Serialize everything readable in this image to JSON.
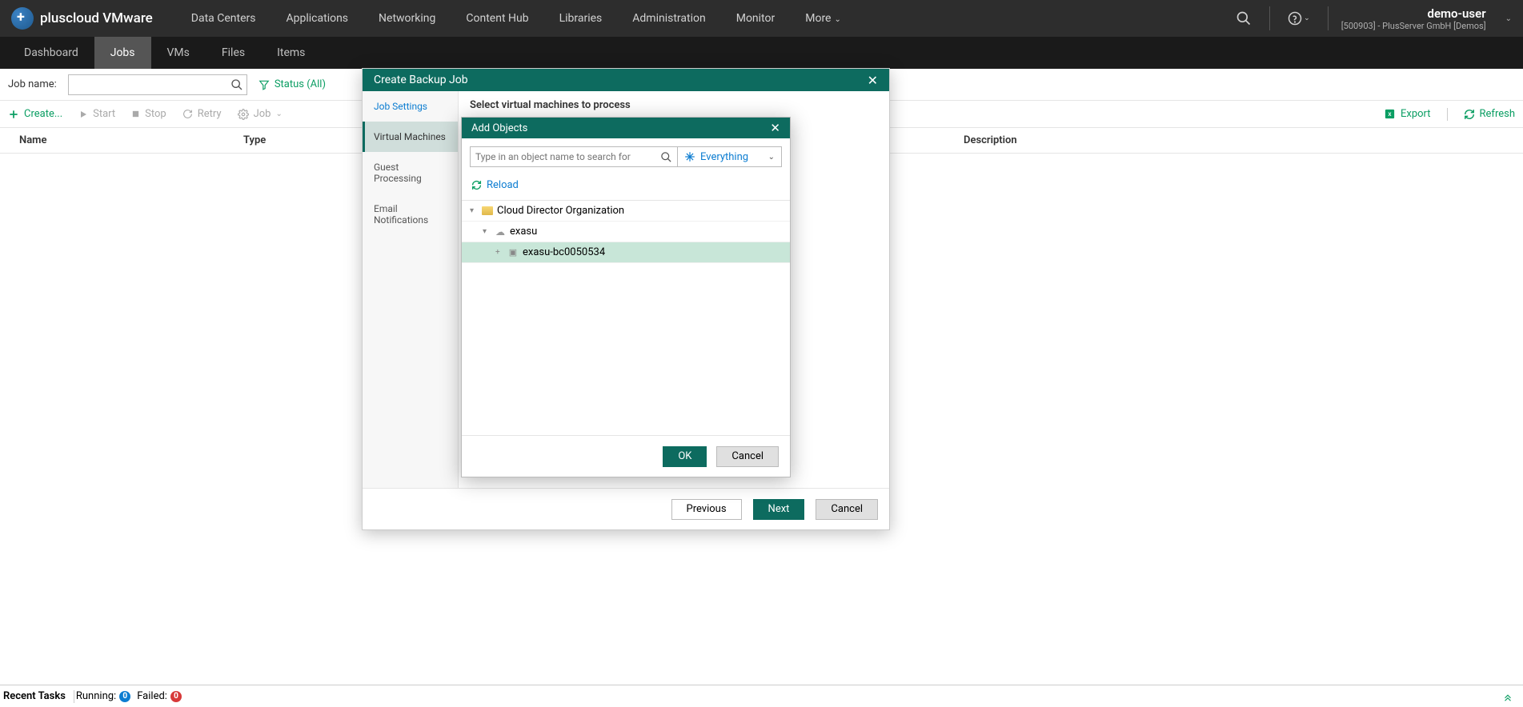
{
  "brand": "pluscloud VMware",
  "topNav": [
    "Data Centers",
    "Applications",
    "Networking",
    "Content Hub",
    "Libraries",
    "Administration",
    "Monitor",
    "More"
  ],
  "user": {
    "name": "demo-user",
    "org": "[500903] - PlusServer GmbH [Demos]"
  },
  "subNav": [
    "Dashboard",
    "Jobs",
    "VMs",
    "Files",
    "Items"
  ],
  "subNavActive": 1,
  "toolbar": {
    "jobNameLabel": "Job name:",
    "statusFilter": "Status (All)"
  },
  "actions": {
    "create": "Create...",
    "start": "Start",
    "stop": "Stop",
    "retry": "Retry",
    "job": "Job",
    "export": "Export",
    "refresh": "Refresh"
  },
  "columns": {
    "name": "Name",
    "type": "Type",
    "desc": "Description"
  },
  "footer": {
    "recent": "Recent Tasks",
    "running": "Running:",
    "runningCount": "0",
    "failed": "Failed:",
    "failedCount": "0"
  },
  "modal1": {
    "title": "Create Backup Job",
    "steps": [
      "Job Settings",
      "Virtual Machines",
      "Guest Processing",
      "Email Notifications"
    ],
    "activeStep": 1,
    "contentTitle": "Select virtual machines to process",
    "prev": "Previous",
    "next": "Next",
    "cancel": "Cancel"
  },
  "modal2": {
    "title": "Add Objects",
    "searchPlaceholder": "Type in an object name to search for",
    "filterLabel": "Everything",
    "reload": "Reload",
    "tree": {
      "root": "Cloud Director Organization",
      "child1": "exasu",
      "child2": "exasu-bc0050534"
    },
    "ok": "OK",
    "cancel": "Cancel"
  }
}
